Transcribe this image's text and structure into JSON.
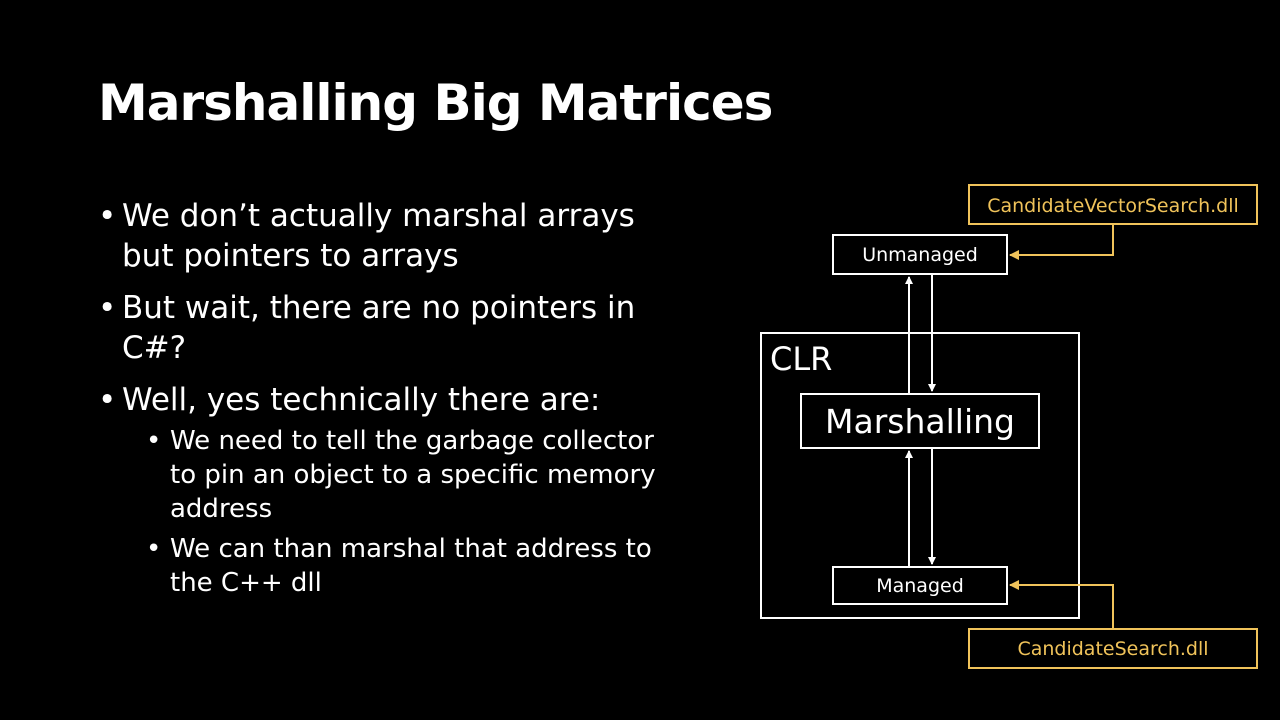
{
  "slide": {
    "title": "Marshalling Big Matrices",
    "bullet_symbol": "•",
    "bullets": [
      {
        "text": "We don’t actually marshal arrays but pointers to arrays"
      },
      {
        "text": "But wait, there are no pointers in C#?"
      },
      {
        "text": "Well, yes technically there are:"
      }
    ],
    "sub_bullets": [
      {
        "text": "We need to tell the garbage collector to pin an object to a specific memory address"
      },
      {
        "text": "We can than marshal that address to the C++  dll"
      }
    ]
  },
  "diagram": {
    "clr_label": "CLR",
    "marshalling_label": "Marshalling",
    "unmanaged_label": "Unmanaged",
    "managed_label": "Managed",
    "dll_top_label": "CandidateVectorSearch.dll",
    "dll_bottom_label": "CandidateSearch.dll",
    "colors": {
      "box": "#ffffff",
      "dll": "#f0c35a",
      "background": "#000000"
    }
  }
}
